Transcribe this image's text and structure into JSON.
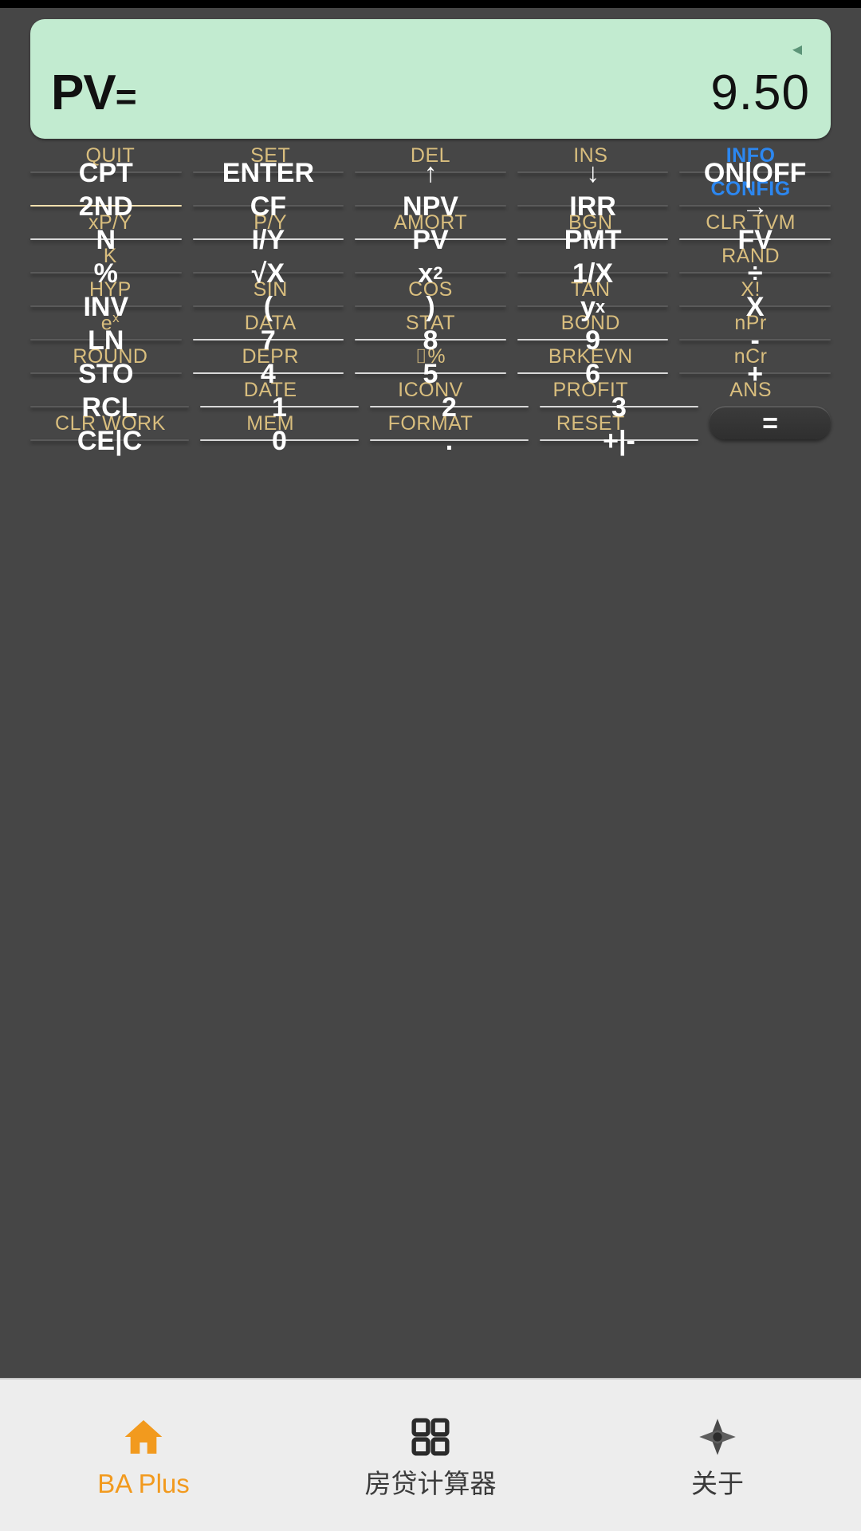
{
  "app": {
    "accent_orange": "#F29A1E",
    "gold_label": "#D9BE7E",
    "blue_label": "#2C87F0",
    "lcd_bg": "#C2EBD0",
    "body_bg": "#464646"
  },
  "display": {
    "label": "PV",
    "equals": "=",
    "value": "9.50",
    "annunciator": "speaker-left-triangle"
  },
  "keypad": {
    "rows": [
      {
        "labels": [
          {
            "text": "QUIT",
            "color": "gold"
          },
          {
            "text": "SET",
            "color": "gold"
          },
          {
            "text": "DEL",
            "color": "gold"
          },
          {
            "text": "INS",
            "color": "gold"
          },
          {
            "text": "INFO",
            "color": "blue"
          }
        ],
        "keys": [
          {
            "label": "CPT",
            "style": "dark"
          },
          {
            "label": "ENTER",
            "style": "dark"
          },
          {
            "label": "↑",
            "style": "dark"
          },
          {
            "label": "↓",
            "style": "dark"
          },
          {
            "label": "ON|OFF",
            "style": "dark"
          }
        ]
      },
      {
        "labels": [
          {
            "text": "",
            "color": "gold"
          },
          {
            "text": "",
            "color": "gold"
          },
          {
            "text": "",
            "color": "gold"
          },
          {
            "text": "",
            "color": "gold"
          },
          {
            "text": "CONFIG",
            "color": "blue"
          }
        ],
        "keys": [
          {
            "label": "2ND",
            "style": "gold"
          },
          {
            "label": "CF",
            "style": "dark"
          },
          {
            "label": "NPV",
            "style": "dark"
          },
          {
            "label": "IRR",
            "style": "dark"
          },
          {
            "label": "→",
            "style": "dark"
          }
        ]
      },
      {
        "labels": [
          {
            "text": "xP/Y",
            "color": "gold"
          },
          {
            "text": "P/Y",
            "color": "gold"
          },
          {
            "text": "AMORT",
            "color": "gold"
          },
          {
            "text": "BGN",
            "color": "gold"
          },
          {
            "text": "CLR TVM",
            "color": "gold"
          }
        ],
        "keys": [
          {
            "label": "N",
            "style": "gray"
          },
          {
            "label": "I/Y",
            "style": "gray"
          },
          {
            "label": "PV",
            "style": "gray"
          },
          {
            "label": "PMT",
            "style": "gray"
          },
          {
            "label": "FV",
            "style": "gray"
          }
        ]
      },
      {
        "labels": [
          {
            "text": "K",
            "color": "gold"
          },
          {
            "text": "",
            "color": "gold"
          },
          {
            "text": "",
            "color": "gold"
          },
          {
            "text": "",
            "color": "gold"
          },
          {
            "text": "RAND",
            "color": "gold"
          }
        ],
        "keys": [
          {
            "label": "%",
            "style": "dark"
          },
          {
            "label": "√X",
            "style": "dark"
          },
          {
            "label": "x",
            "sup": "2",
            "style": "dark"
          },
          {
            "label": "1/X",
            "style": "dark"
          },
          {
            "label": "÷",
            "style": "dark"
          }
        ]
      },
      {
        "labels": [
          {
            "text": "HYP",
            "color": "gold"
          },
          {
            "text": "SIN",
            "color": "gold"
          },
          {
            "text": "COS",
            "color": "gold"
          },
          {
            "text": "TAN",
            "color": "gold"
          },
          {
            "text": "X!",
            "color": "gold"
          }
        ],
        "keys": [
          {
            "label": "INV",
            "style": "dark"
          },
          {
            "label": "(",
            "style": "dark"
          },
          {
            "label": ")",
            "style": "dark"
          },
          {
            "label": "y",
            "sup": "x",
            "style": "dark"
          },
          {
            "label": "X",
            "style": "dark"
          }
        ]
      },
      {
        "labels": [
          {
            "text": "e",
            "sup": "x",
            "color": "gold"
          },
          {
            "text": "DATA",
            "color": "gold"
          },
          {
            "text": "STAT",
            "color": "gold"
          },
          {
            "text": "BOND",
            "color": "gold"
          },
          {
            "text": "nPr",
            "color": "gold"
          }
        ],
        "keys": [
          {
            "label": "LN",
            "style": "dark"
          },
          {
            "label": "7",
            "style": "gray"
          },
          {
            "label": "8",
            "style": "gray"
          },
          {
            "label": "9",
            "style": "gray"
          },
          {
            "label": "-",
            "style": "dark"
          }
        ]
      },
      {
        "labels": [
          {
            "text": "ROUND",
            "color": "gold"
          },
          {
            "text": "DEPR",
            "color": "gold"
          },
          {
            "text": "⌷%",
            "color": "gold"
          },
          {
            "text": "BRKEVN",
            "color": "gold"
          },
          {
            "text": "nCr",
            "color": "gold"
          }
        ],
        "keys": [
          {
            "label": "STO",
            "style": "dark"
          },
          {
            "label": "4",
            "style": "gray"
          },
          {
            "label": "5",
            "style": "gray"
          },
          {
            "label": "6",
            "style": "gray"
          },
          {
            "label": "+",
            "style": "dark"
          }
        ]
      },
      {
        "labels": [
          {
            "text": "",
            "color": "gold"
          },
          {
            "text": "DATE",
            "color": "gold"
          },
          {
            "text": "ICONV",
            "color": "gold"
          },
          {
            "text": "PROFIT",
            "color": "gold"
          },
          {
            "text": "ANS",
            "color": "gold"
          }
        ],
        "keys": [
          {
            "label": "RCL",
            "style": "dark"
          },
          {
            "label": "1",
            "style": "gray"
          },
          {
            "label": "2",
            "style": "gray"
          },
          {
            "label": "3",
            "style": "gray"
          }
        ]
      },
      {
        "labels": [
          {
            "text": "CLR WORK",
            "color": "gold"
          },
          {
            "text": "MEM",
            "color": "gold"
          },
          {
            "text": "FORMAT",
            "color": "gold"
          },
          {
            "text": "RESET",
            "color": "gold"
          },
          {
            "text": "",
            "color": "gold"
          }
        ],
        "keys": [
          {
            "label": "CE|C",
            "style": "dark"
          },
          {
            "label": "0",
            "style": "gray"
          },
          {
            "label": ".",
            "style": "gray"
          },
          {
            "label": "+|-",
            "style": "gray"
          }
        ]
      }
    ],
    "equals_key": {
      "label": "=",
      "style": "dark"
    }
  },
  "navbar": {
    "items": [
      {
        "label": "BA Plus",
        "icon": "home-icon",
        "active": true
      },
      {
        "label": "房贷计算器",
        "icon": "grid-icon",
        "active": false
      },
      {
        "label": "关于",
        "icon": "compass-icon",
        "active": false
      }
    ]
  }
}
